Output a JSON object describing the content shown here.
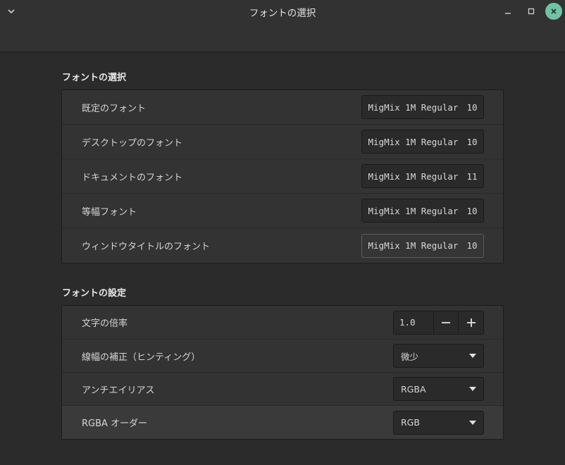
{
  "window": {
    "title": "フォントの選択"
  },
  "selection": {
    "heading": "フォントの選択",
    "rows": [
      {
        "label": "既定のフォント",
        "font": "MigMix 1M Regular",
        "size": "10"
      },
      {
        "label": "デスクトップのフォント",
        "font": "MigMix 1M Regular",
        "size": "10"
      },
      {
        "label": "ドキュメントのフォント",
        "font": "MigMix 1M Regular",
        "size": "11"
      },
      {
        "label": "等幅フォント",
        "font": "MigMix 1M Regular",
        "size": "10"
      },
      {
        "label": "ウィンドウタイトルのフォント",
        "font": "MigMix 1M Regular",
        "size": "10"
      }
    ]
  },
  "settings": {
    "heading": "フォントの設定",
    "scale": {
      "label": "文字の倍率",
      "value": "1.0"
    },
    "hinting": {
      "label": "線幅の補正（ヒンティング）",
      "value": "微少"
    },
    "antialias": {
      "label": "アンチエイリアス",
      "value": "RGBA"
    },
    "rgba_order": {
      "label": "RGBA オーダー",
      "value": "RGB"
    }
  },
  "colors": {
    "close_button": "#6ec3a3",
    "background": "#2b2b2b",
    "panel": "#333333"
  }
}
